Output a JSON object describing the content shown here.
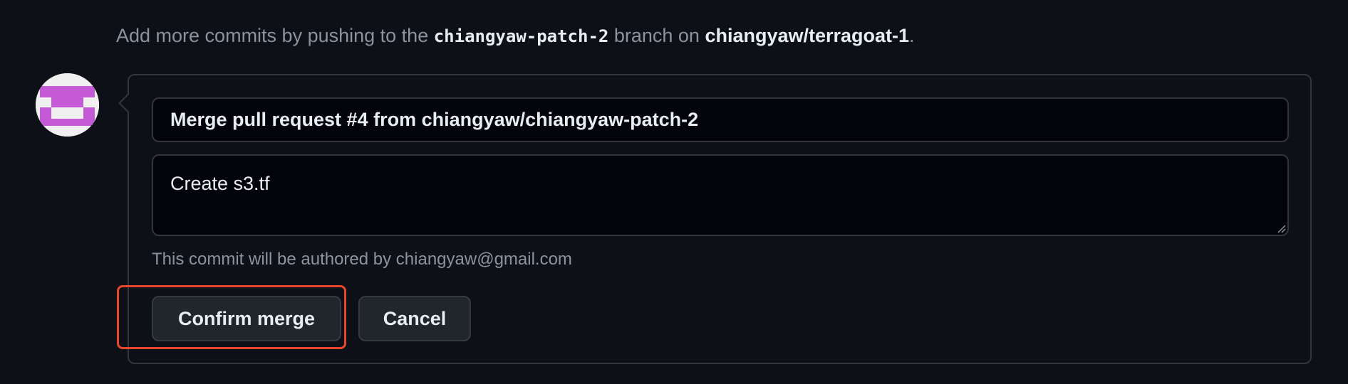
{
  "hint": {
    "prefix": "Add more commits by pushing to the ",
    "branch": "chiangyaw-patch-2",
    "middle": " branch on ",
    "repo": "chiangyaw/terragoat-1",
    "suffix": "."
  },
  "merge_form": {
    "title_value": "Merge pull request #4 from chiangyaw/chiangyaw-patch-2",
    "body_value": "Create s3.tf",
    "author_note": "This commit will be authored by chiangyaw@gmail.com",
    "confirm_label": "Confirm merge",
    "cancel_label": "Cancel"
  },
  "colors": {
    "background": "#0d1117",
    "border": "#30363d",
    "highlight": "#e8472b",
    "avatar_accent": "#c45ad6"
  },
  "icons": {
    "avatar": "identicon-avatar",
    "resize": "resize-grip-icon"
  }
}
